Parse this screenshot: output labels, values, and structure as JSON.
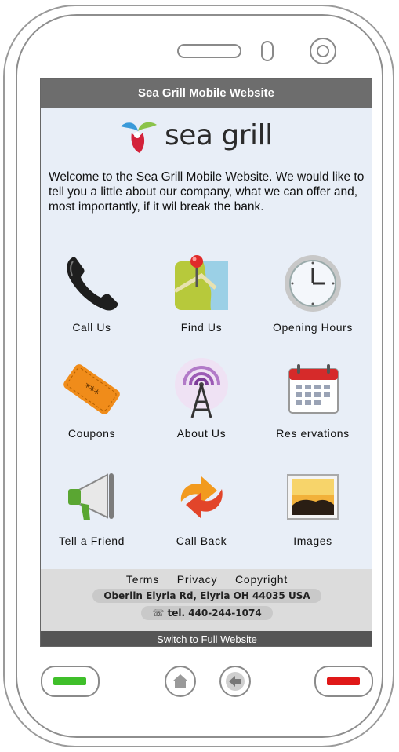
{
  "titlebar": {
    "title": "Sea Grill Mobile Website"
  },
  "logo": {
    "text": "sea grill"
  },
  "welcome": {
    "text": "Welcome to the Sea Grill Mobile Website.  We would like to tell you a little about our  company, what we can offer and, most importantly, if it wil break the bank."
  },
  "tiles": [
    {
      "label": "Call Us",
      "icon": "phone-icon"
    },
    {
      "label": "Find Us",
      "icon": "map-pin-icon"
    },
    {
      "label": "Opening Hours",
      "icon": "clock-icon"
    },
    {
      "label": "Coupons",
      "icon": "ticket-icon"
    },
    {
      "label": "About Us",
      "icon": "broadcast-icon"
    },
    {
      "label": "Res ervations",
      "icon": "calendar-icon"
    },
    {
      "label": "Tell a Friend",
      "icon": "megaphone-icon"
    },
    {
      "label": "Call Back",
      "icon": "refresh-icon"
    },
    {
      "label": "Images",
      "icon": "image-icon"
    }
  ],
  "footer": {
    "links": [
      "Terms",
      "Privacy",
      "Copyright"
    ],
    "address": "Oberlin Elyria Rd, Elyria OH 44035 USA",
    "phone": "tel. 440-244-1074",
    "switch": "Switch to Full Website"
  },
  "colors": {
    "screen_bg": "#e8eef7",
    "titlebar_bg": "#6d6d6d",
    "call_button": "#3fbf2a",
    "end_button": "#e01818"
  }
}
